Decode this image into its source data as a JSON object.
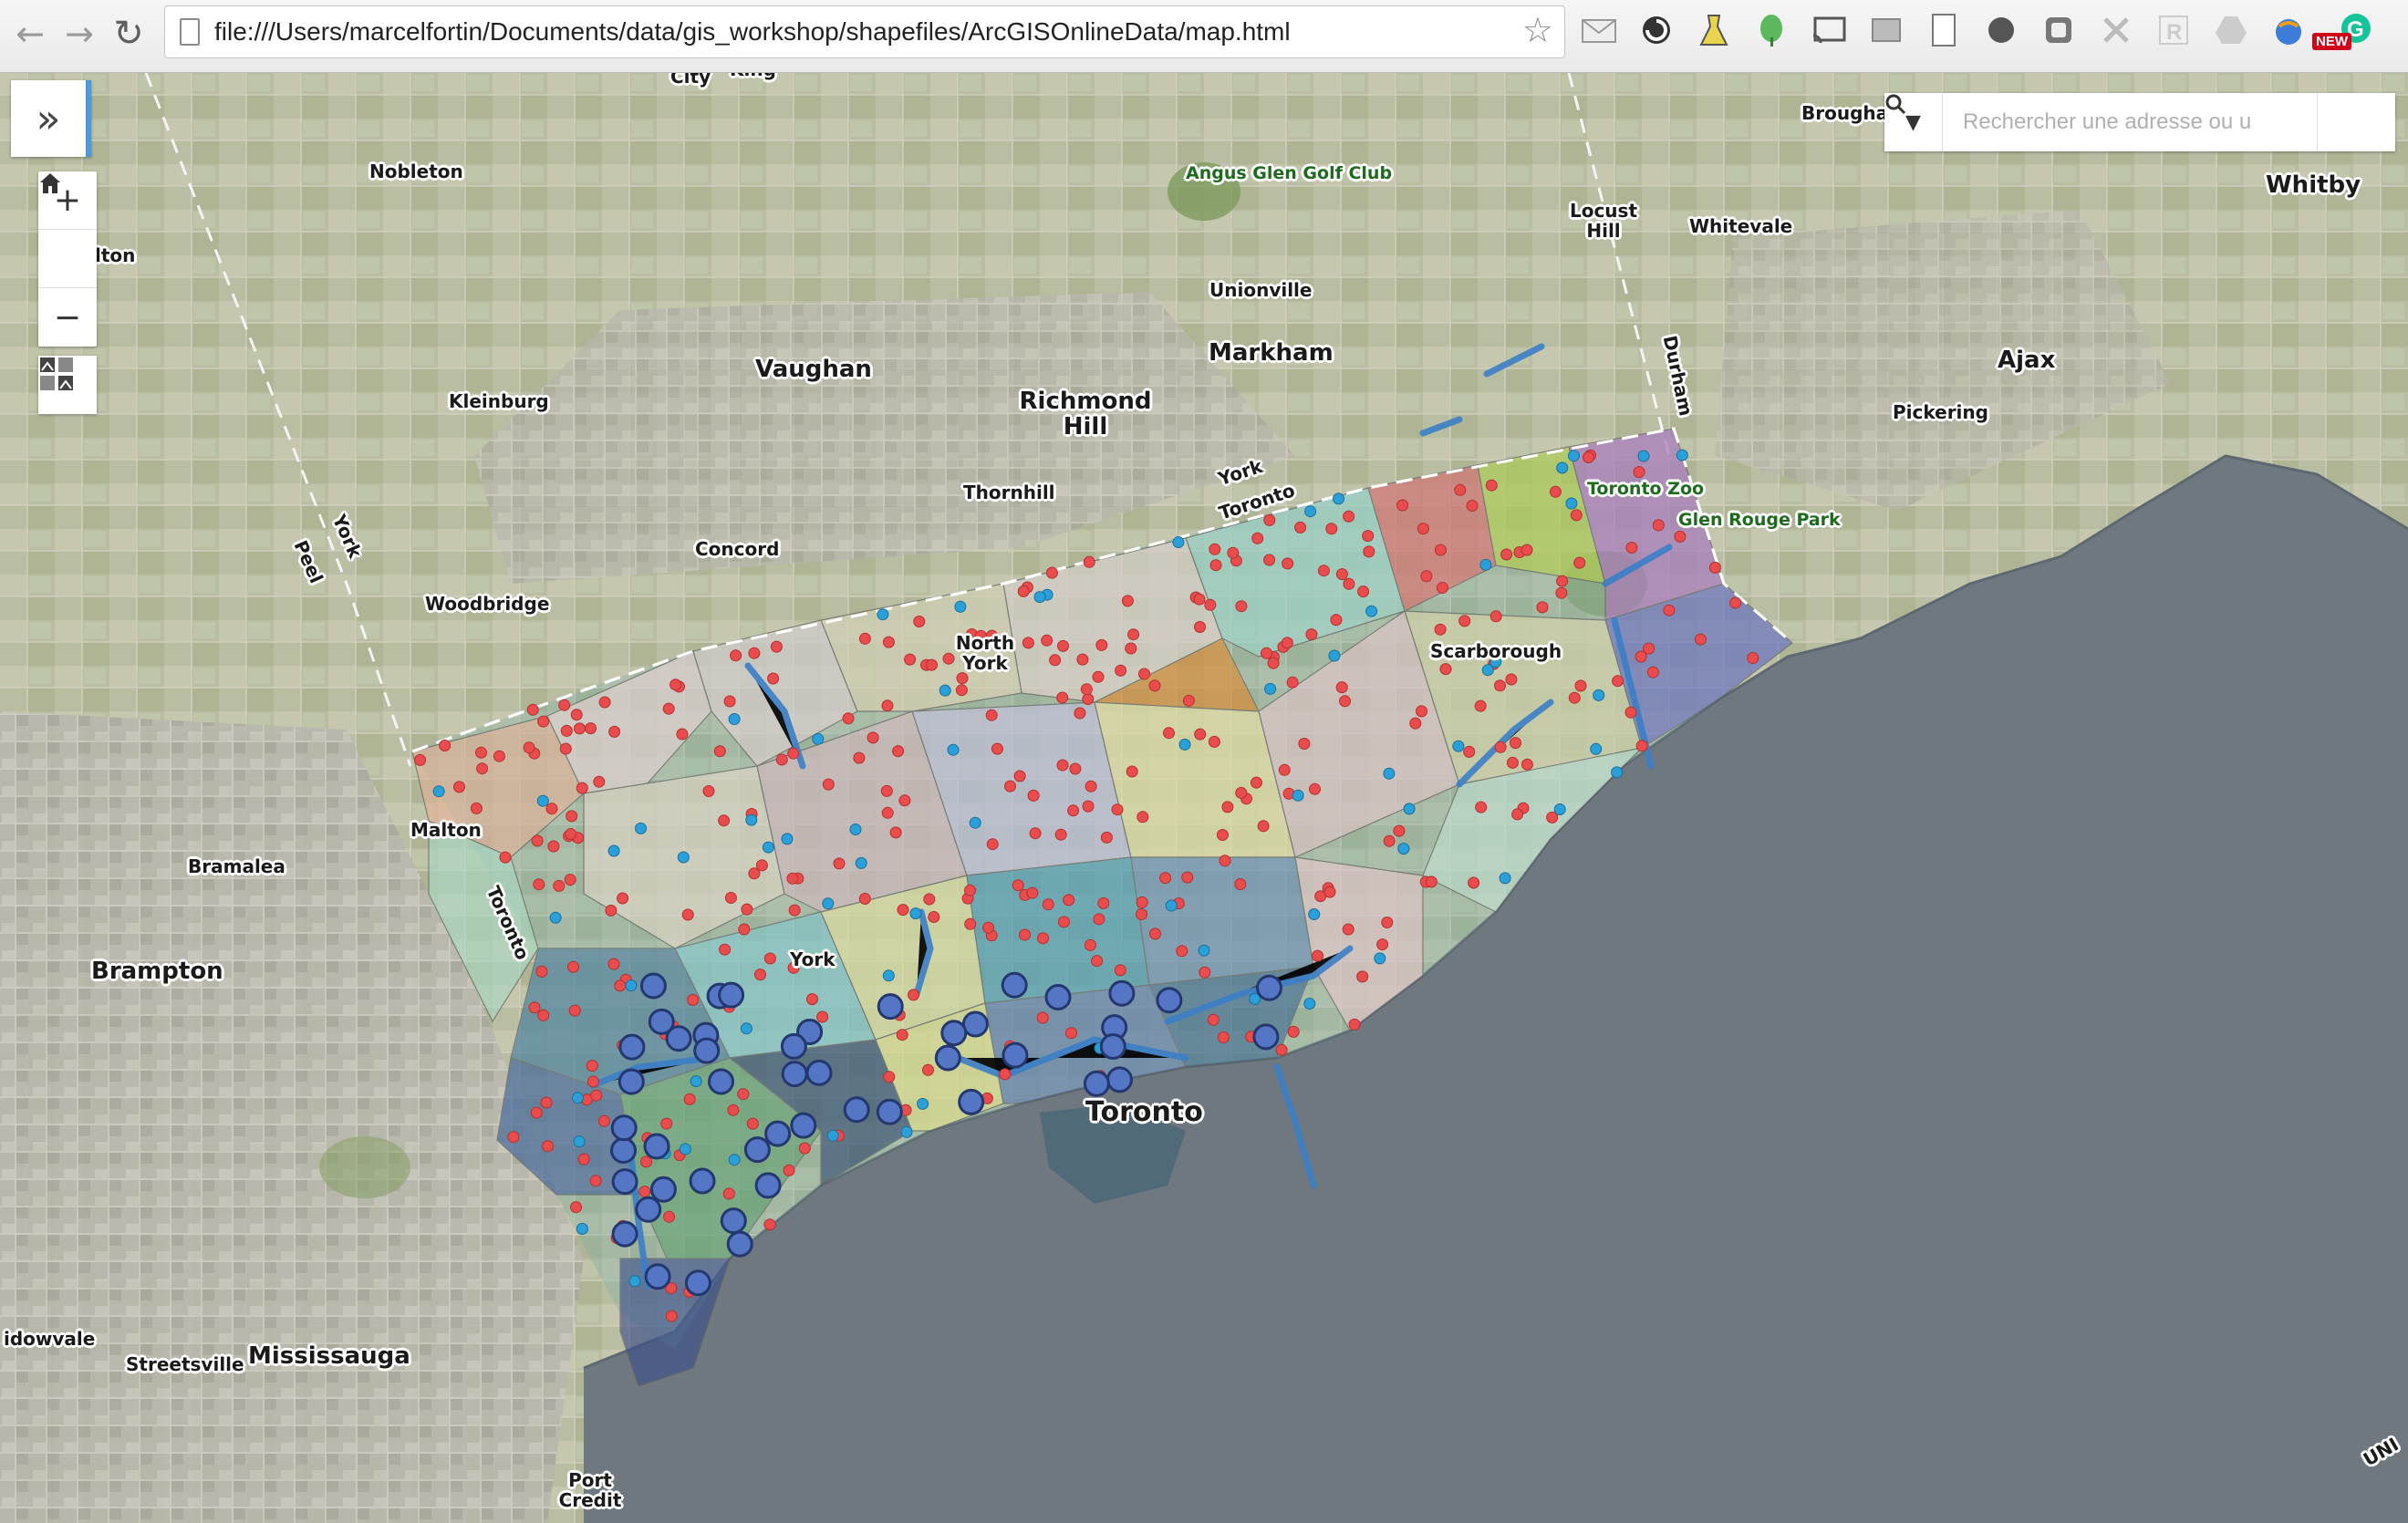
{
  "browser": {
    "url": "file:///Users/marcelfortin/Documents/data/gis_workshop/shapefiles/ArcGISOnlineData/map.html",
    "badge": "NEW"
  },
  "search": {
    "placeholder": "Rechercher une adresse ou u"
  },
  "map": {
    "labels": [
      {
        "text": "City",
        "size": "sm"
      },
      {
        "text": "King",
        "size": "sm"
      },
      {
        "text": "Nobleton",
        "size": "sm"
      },
      {
        "text": "lton",
        "size": "sm"
      },
      {
        "text": "Angus Glen Golf Club",
        "size": "park"
      },
      {
        "text": "Locust Hill",
        "size": "sm"
      },
      {
        "text": "Whitevale",
        "size": "sm"
      },
      {
        "text": "Brougham",
        "size": "sm"
      },
      {
        "text": "Whitby",
        "size": "md"
      },
      {
        "text": "Unionville",
        "size": "sm"
      },
      {
        "text": "Vaughan",
        "size": "md"
      },
      {
        "text": "Markham",
        "size": "md"
      },
      {
        "text": "Richmond Hill",
        "size": "md"
      },
      {
        "text": "Kleinburg",
        "size": "sm"
      },
      {
        "text": "Durham",
        "size": "sm"
      },
      {
        "text": "Ajax",
        "size": "md"
      },
      {
        "text": "Pickering",
        "size": "sm"
      },
      {
        "text": "Thornhill",
        "size": "sm"
      },
      {
        "text": "York",
        "size": "sm"
      },
      {
        "text": "Toronto",
        "size": "sm"
      },
      {
        "text": "Toronto Zoo",
        "size": "park"
      },
      {
        "text": "Glen Rouge Park",
        "size": "park"
      },
      {
        "text": "York",
        "size": "sm"
      },
      {
        "text": "Peel",
        "size": "sm"
      },
      {
        "text": "Concord",
        "size": "sm"
      },
      {
        "text": "Woodbridge",
        "size": "sm"
      },
      {
        "text": "North York",
        "size": "sm"
      },
      {
        "text": "Scarborough",
        "size": "sm"
      },
      {
        "text": "Malton",
        "size": "sm"
      },
      {
        "text": "Bramalea",
        "size": "sm"
      },
      {
        "text": "Toronto",
        "size": "sm"
      },
      {
        "text": "Brampton",
        "size": "md"
      },
      {
        "text": "York",
        "size": "sm"
      },
      {
        "text": "Toronto",
        "size": "lg"
      },
      {
        "text": "idowvale",
        "size": "sm"
      },
      {
        "text": "Streetsville",
        "size": "sm"
      },
      {
        "text": "Mississauga",
        "size": "md"
      },
      {
        "text": "Port Credit",
        "size": "sm"
      },
      {
        "text": "UNI",
        "size": "sm"
      }
    ]
  }
}
